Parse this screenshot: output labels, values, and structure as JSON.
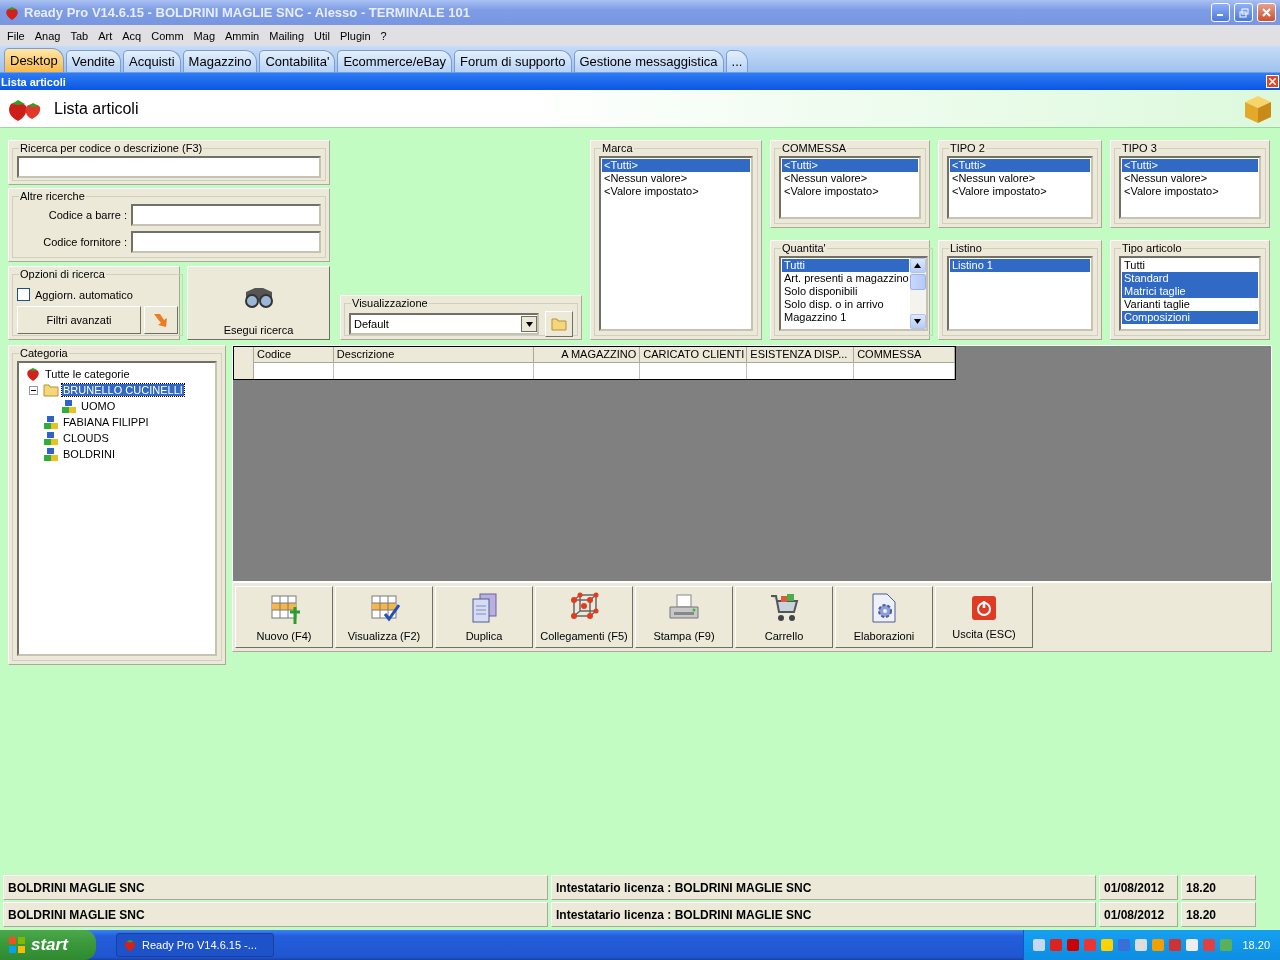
{
  "window": {
    "title": "Ready Pro V14.6.15 - BOLDRINI MAGLIE SNC - Alesso - TERMINALE 101"
  },
  "menu": [
    "File",
    "Anag",
    "Tab",
    "Art",
    "Acq",
    "Comm",
    "Mag",
    "Ammin",
    "Mailing",
    "Util",
    "Plugin",
    "?"
  ],
  "tabs": [
    {
      "label": "Desktop",
      "selected": true
    },
    {
      "label": "Vendite",
      "selected": false
    },
    {
      "label": "Acquisti",
      "selected": false
    },
    {
      "label": "Magazzino",
      "selected": false
    },
    {
      "label": "Contabilita'",
      "selected": false
    },
    {
      "label": "Ecommerce/eBay",
      "selected": false
    },
    {
      "label": "Forum di supporto",
      "selected": false
    },
    {
      "label": "Gestione messaggistica",
      "selected": false
    },
    {
      "label": "...",
      "selected": false
    }
  ],
  "subwindow": {
    "title": "Lista articoli",
    "heading": "Lista articoli"
  },
  "search": {
    "label": "Ricerca per codice o descrizione (F3)"
  },
  "other_searches": {
    "label": "Altre ricerche",
    "fields": [
      "Codice a barre :",
      "Codice fornitore :"
    ]
  },
  "options": {
    "label": "Opzioni di ricerca",
    "auto_update": {
      "label": "Aggiorn. automatico",
      "checked": false
    },
    "advanced_button": "Filtri avanzati"
  },
  "search_button": "Esegui ricerca",
  "view": {
    "label": "Visualizzazione",
    "value": "Default"
  },
  "brand": {
    "label": "Marca",
    "items": [
      {
        "label": "<Tutti>",
        "selected": true
      },
      {
        "label": "<Nessun valore>",
        "selected": false
      },
      {
        "label": "<Valore impostato>",
        "selected": false
      }
    ]
  },
  "filters": [
    {
      "label": "COMMESSA",
      "kind": "plain",
      "items": [
        {
          "label": "<Tutti>",
          "selected": true
        },
        {
          "label": "<Nessun valore>",
          "selected": false
        },
        {
          "label": "<Valore impostato>",
          "selected": false
        }
      ]
    },
    {
      "label": "TIPO 2",
      "kind": "plain",
      "items": [
        {
          "label": "<Tutti>",
          "selected": true
        },
        {
          "label": "<Nessun valore>",
          "selected": false
        },
        {
          "label": "<Valore impostato>",
          "selected": false
        }
      ]
    },
    {
      "label": "TIPO  3",
      "kind": "plain",
      "items": [
        {
          "label": "<Tutti>",
          "selected": true
        },
        {
          "label": "<Nessun valore>",
          "selected": false
        },
        {
          "label": "<Valore impostato>",
          "selected": false
        }
      ]
    },
    {
      "label": "Quantita'",
      "kind": "scroll",
      "items": [
        {
          "label": "Tutti",
          "selected": true
        },
        {
          "label": "Art. presenti a magazzino",
          "selected": false
        },
        {
          "label": "Solo disponibili",
          "selected": false
        },
        {
          "label": "Solo disp. o in arrivo",
          "selected": false
        },
        {
          "label": "Magazzino 1",
          "selected": false
        }
      ]
    },
    {
      "label": "Listino",
      "kind": "plain",
      "items": [
        {
          "label": "Listino 1",
          "selected": true
        }
      ]
    },
    {
      "label": "Tipo articolo",
      "kind": "plain",
      "items": [
        {
          "label": "Tutti",
          "selected": false
        },
        {
          "label": "Standard",
          "selected": true
        },
        {
          "label": "Matrici taglie",
          "selected": true
        },
        {
          "label": "Varianti taglie",
          "selected": false
        },
        {
          "label": "Composizioni",
          "selected": true
        }
      ]
    }
  ],
  "category": {
    "label": "Categoria",
    "tree": [
      {
        "label": "Tutte le categorie",
        "kind": "root",
        "selected": false,
        "children": [
          {
            "label": "BRUNELLO CUCINELLI",
            "kind": "folder",
            "selected": true,
            "expanded": true,
            "children": [
              {
                "label": "UOMO",
                "kind": "group",
                "selected": false
              }
            ]
          },
          {
            "label": "FABIANA FILIPPI",
            "kind": "group",
            "selected": false
          },
          {
            "label": "CLOUDS",
            "kind": "group",
            "selected": false
          },
          {
            "label": "BOLDRINI",
            "kind": "group",
            "selected": false
          }
        ]
      }
    ]
  },
  "table": {
    "columns": [
      {
        "label": "Codice",
        "kind": "text"
      },
      {
        "label": "Descrizione",
        "kind": "text"
      },
      {
        "label": "A MAGAZZINO",
        "kind": "number"
      },
      {
        "label": "CARICATO CLIENTI",
        "kind": "text"
      },
      {
        "label": "ESISTENZA DISP...",
        "kind": "text"
      },
      {
        "label": "COMMESSA",
        "kind": "text"
      }
    ]
  },
  "actions": [
    "Nuovo (F4)",
    "Visualizza (F2)",
    "Duplica",
    "Collegamenti (F5)",
    "Stampa (F9)",
    "Carrello",
    "Elaborazioni",
    "Uscita (ESC)"
  ],
  "status_rows": [
    {
      "company": "BOLDRINI MAGLIE SNC",
      "license": "Intestatario licenza : BOLDRINI MAGLIE SNC",
      "date": "01/08/2012",
      "time": "18.20"
    },
    {
      "company": "BOLDRINI MAGLIE SNC",
      "license": "Intestatario licenza : BOLDRINI MAGLIE SNC",
      "date": "01/08/2012",
      "time": "18.20"
    }
  ],
  "taskbar": {
    "start": "start",
    "task": "Ready Pro V14.6.15 -...",
    "clock": "18.20"
  }
}
